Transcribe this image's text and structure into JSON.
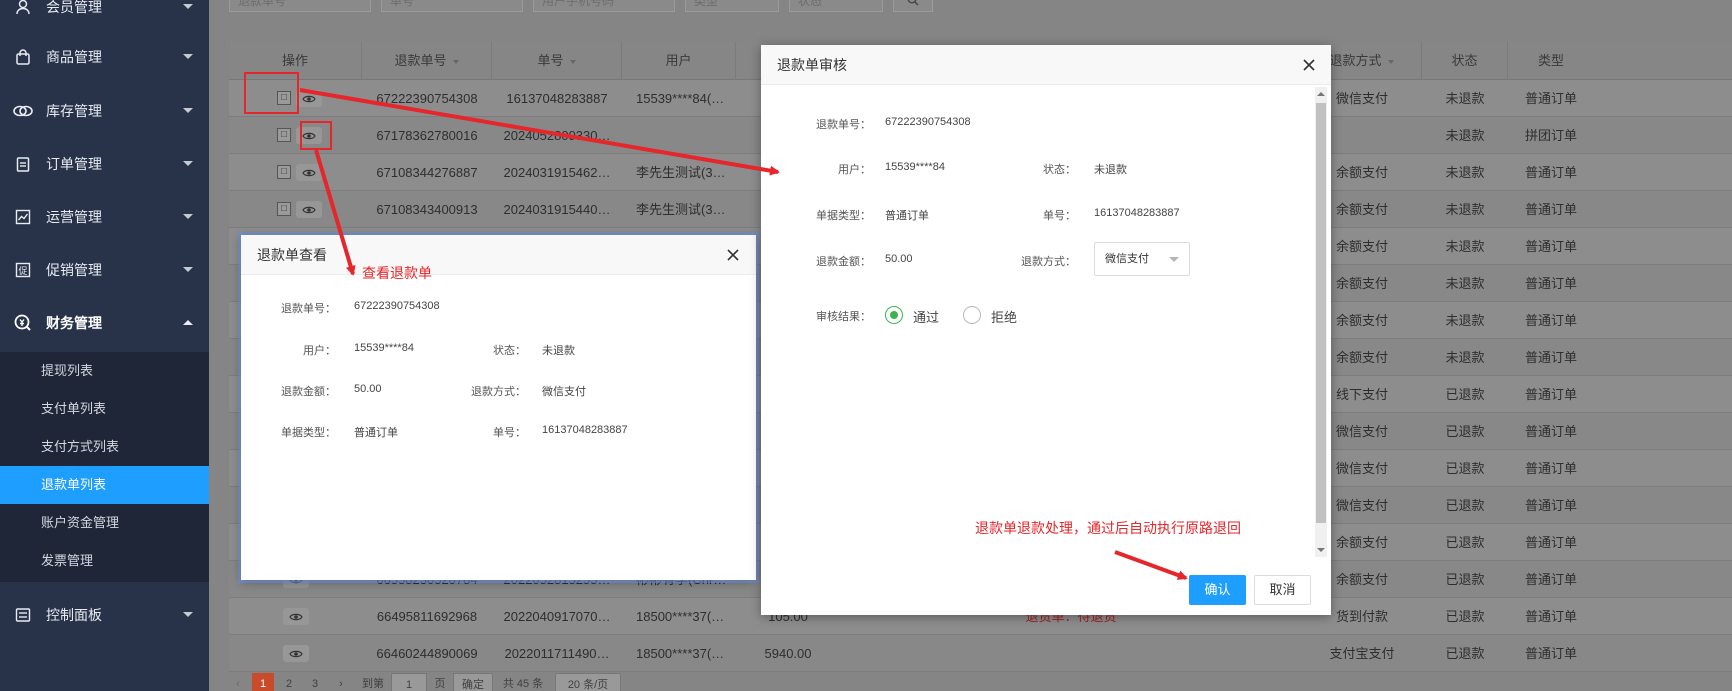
{
  "sidebar": {
    "menu": [
      {
        "label": "会员管理",
        "icon": "user-icon"
      },
      {
        "label": "商品管理",
        "icon": "bag-icon"
      },
      {
        "label": "库存管理",
        "icon": "link-icon"
      },
      {
        "label": "订单管理",
        "icon": "clipboard-icon"
      },
      {
        "label": "运营管理",
        "icon": "trend-chart-icon"
      },
      {
        "label": "促销管理",
        "icon": "promotion-icon"
      },
      {
        "label": "财务管理",
        "icon": "money-icon"
      },
      {
        "label": "控制面板",
        "icon": "control-panel-icon"
      }
    ],
    "finance_sub": [
      {
        "label": "提现列表"
      },
      {
        "label": "支付单列表"
      },
      {
        "label": "支付方式列表"
      },
      {
        "label": "退款单列表"
      },
      {
        "label": "账户资金管理"
      },
      {
        "label": "发票管理"
      }
    ]
  },
  "search": {
    "refund_no": "退款单号",
    "order_no": "单号",
    "user_mobile": "用户手机号码",
    "type": "类型",
    "status": "状态"
  },
  "table": {
    "headers": {
      "op": "操作",
      "refund_no": "退款单号",
      "order_no": "单号",
      "user": "用户",
      "method": "退款方式",
      "status": "状态",
      "type": "类型"
    },
    "rows": [
      {
        "refund_no": "67222390754308",
        "order_no": "16137048283887",
        "user": "15539****84(…",
        "amount": "",
        "note": "",
        "method": "微信支付",
        "status": "未退款",
        "type": "普通订单"
      },
      {
        "refund_no": "67178362780016",
        "order_no": "2024052809330…",
        "user": "",
        "amount": "",
        "note": "",
        "method": "",
        "status": "未退款",
        "type": "拼团订单"
      },
      {
        "refund_no": "67108344276887",
        "order_no": "2024031915462…",
        "user": "李先生测试(3…",
        "amount": "",
        "note": "",
        "method": "余额支付",
        "status": "未退款",
        "type": "普通订单"
      },
      {
        "refund_no": "67108343400913",
        "order_no": "2024031915440…",
        "user": "李先生测试(3…",
        "amount": "",
        "note": "",
        "method": "余额支付",
        "status": "未退款",
        "type": "普通订单"
      },
      {
        "refund_no": "",
        "order_no": "",
        "user": "",
        "amount": "",
        "note": "",
        "method": "余额支付",
        "status": "未退款",
        "type": "普通订单"
      },
      {
        "refund_no": "",
        "order_no": "",
        "user": "",
        "amount": "",
        "note": "",
        "method": "余额支付",
        "status": "未退款",
        "type": "普通订单"
      },
      {
        "refund_no": "",
        "order_no": "",
        "user": "",
        "amount": "",
        "note": "",
        "method": "余额支付",
        "status": "未退款",
        "type": "普通订单"
      },
      {
        "refund_no": "",
        "order_no": "",
        "user": "",
        "amount": "",
        "note": "",
        "method": "余额支付",
        "status": "未退款",
        "type": "普通订单"
      },
      {
        "refund_no": "",
        "order_no": "",
        "user": "",
        "amount": "",
        "note": "",
        "method": "线下支付",
        "status": "已退款",
        "type": "普通订单"
      },
      {
        "refund_no": "",
        "order_no": "",
        "user": "",
        "amount": "",
        "note": "",
        "method": "微信支付",
        "status": "已退款",
        "type": "普通订单"
      },
      {
        "refund_no": "",
        "order_no": "",
        "user": "",
        "amount": "",
        "note": "",
        "method": "微信支付",
        "status": "已退款",
        "type": "普通订单"
      },
      {
        "refund_no": "",
        "order_no": "",
        "user": "",
        "amount": "",
        "note": "",
        "method": "微信支付",
        "status": "已退款",
        "type": "普通订单"
      },
      {
        "refund_no": "",
        "order_no": "",
        "user": "",
        "amount": "",
        "note": "",
        "method": "余额支付",
        "status": "已退款",
        "type": "普通订单"
      },
      {
        "refund_no": "66558230520784",
        "order_no": "2022052815255…",
        "user": "彬彬有李(Chr…",
        "amount": "",
        "note": "",
        "method": "余额支付",
        "status": "已退款",
        "type": "普通订单"
      },
      {
        "refund_no": "66495811692968",
        "order_no": "2022040917070…",
        "user": "18500****37(…",
        "amount": "105.00",
        "note": "退货单：待退货",
        "method": "货到付款",
        "status": "已退款",
        "type": "普通订单"
      },
      {
        "refund_no": "66460244890069",
        "order_no": "2022011711490…",
        "user": "18500****37(…",
        "amount": "5940.00",
        "note": "",
        "method": "支付宝支付",
        "status": "已退款",
        "type": "普通订单"
      }
    ]
  },
  "pager": {
    "prev": "‹",
    "pages": [
      "1",
      "2",
      "3"
    ],
    "next": "›",
    "goto_label": "到第",
    "goto_value": "1",
    "page_unit": "页",
    "confirm": "确定",
    "total": "共 45 条",
    "per_page": "20 条/页"
  },
  "view_dialog": {
    "title": "退款单查看",
    "fields": {
      "refund_no_label": "退款单号：",
      "refund_no": "67222390754308",
      "user_label": "用户：",
      "user": "15539****84",
      "status_label": "状态：",
      "status": "未退款",
      "amount_label": "退款金额：",
      "amount": "50.00",
      "method_label": "退款方式：",
      "method": "微信支付",
      "doc_type_label": "单据类型：",
      "doc_type": "普通订单",
      "order_no_label": "单号：",
      "order_no": "16137048283887"
    }
  },
  "audit_dialog": {
    "title": "退款单审核",
    "fields": {
      "refund_no_label": "退款单号：",
      "refund_no": "67222390754308",
      "user_label": "用户：",
      "user": "15539****84",
      "status_label": "状态：",
      "status": "未退款",
      "doc_type_label": "单据类型：",
      "doc_type": "普通订单",
      "order_no_label": "单号：",
      "order_no": "16137048283887",
      "amount_label": "退款金额：",
      "amount": "50.00",
      "method_label": "退款方式：",
      "method": "微信支付",
      "result_label": "审核结果：",
      "pass": "通过",
      "reject": "拒绝"
    },
    "confirm": "确认",
    "cancel": "取消"
  },
  "annotations": {
    "view_label": "查看退款单",
    "process_label": "退款单退款处理，通过后自动执行原路退回"
  },
  "colors": {
    "sidebar": "#28334a",
    "accent": "#1e9fff",
    "annotation": "#e5262a",
    "radio_on": "#39b54a"
  }
}
